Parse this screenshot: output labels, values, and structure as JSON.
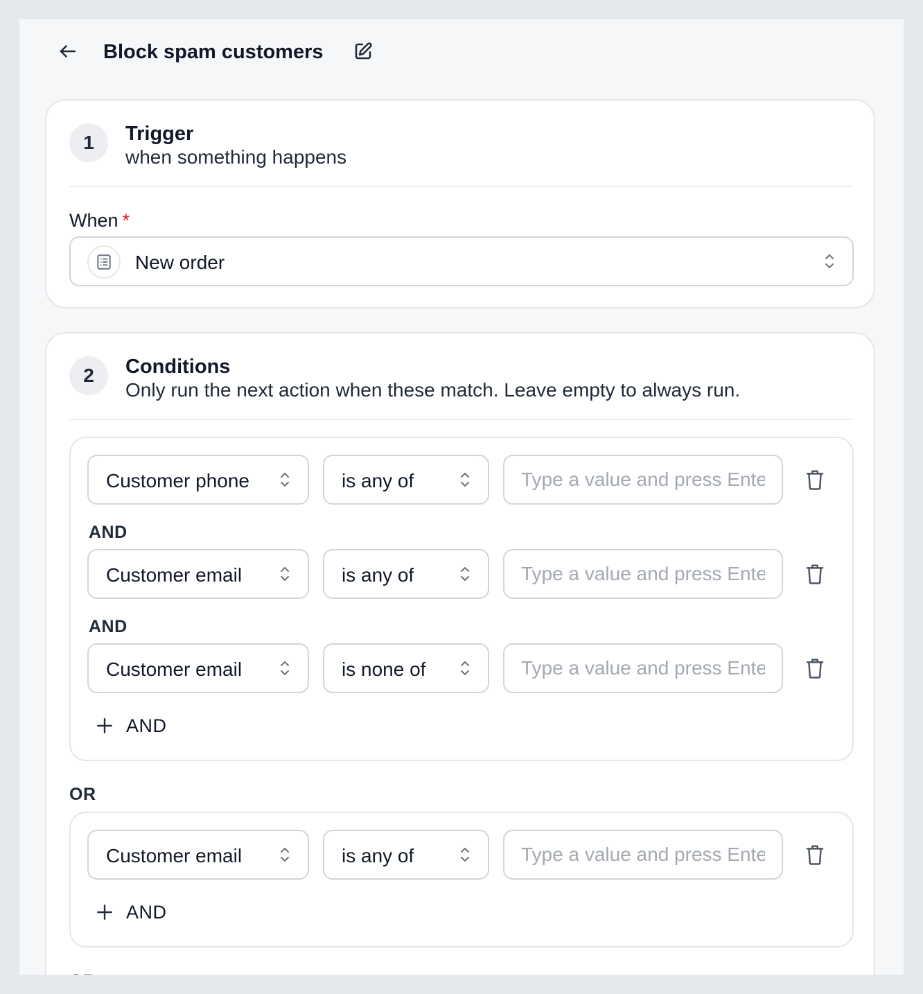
{
  "header": {
    "title": "Block spam customers",
    "back_icon": "arrow-left-icon",
    "edit_icon": "edit-icon"
  },
  "trigger": {
    "step": "1",
    "title": "Trigger",
    "subtitle": "when something happens",
    "field_label": "When",
    "required_mark": "*",
    "selected": "New order"
  },
  "conditions": {
    "step": "2",
    "title": "Conditions",
    "subtitle": "Only run the next action when these match. Leave empty to always run.",
    "and_label": "AND",
    "or_label": "OR",
    "add_and_label": "AND",
    "value_placeholder": "Type a value and press Enter",
    "groups": [
      {
        "rows": [
          {
            "field": "Customer phone",
            "operator": "is any of",
            "value": ""
          },
          {
            "field": "Customer email",
            "operator": "is any of",
            "value": ""
          },
          {
            "field": "Customer email",
            "operator": "is none of",
            "value": ""
          }
        ]
      },
      {
        "rows": [
          {
            "field": "Customer email",
            "operator": "is any of",
            "value": ""
          }
        ]
      }
    ]
  },
  "colors": {
    "background": "#e6e9ec",
    "surface": "#ffffff",
    "border": "#d1d5db",
    "required": "#dc2626",
    "placeholder": "#a3a9b2"
  }
}
